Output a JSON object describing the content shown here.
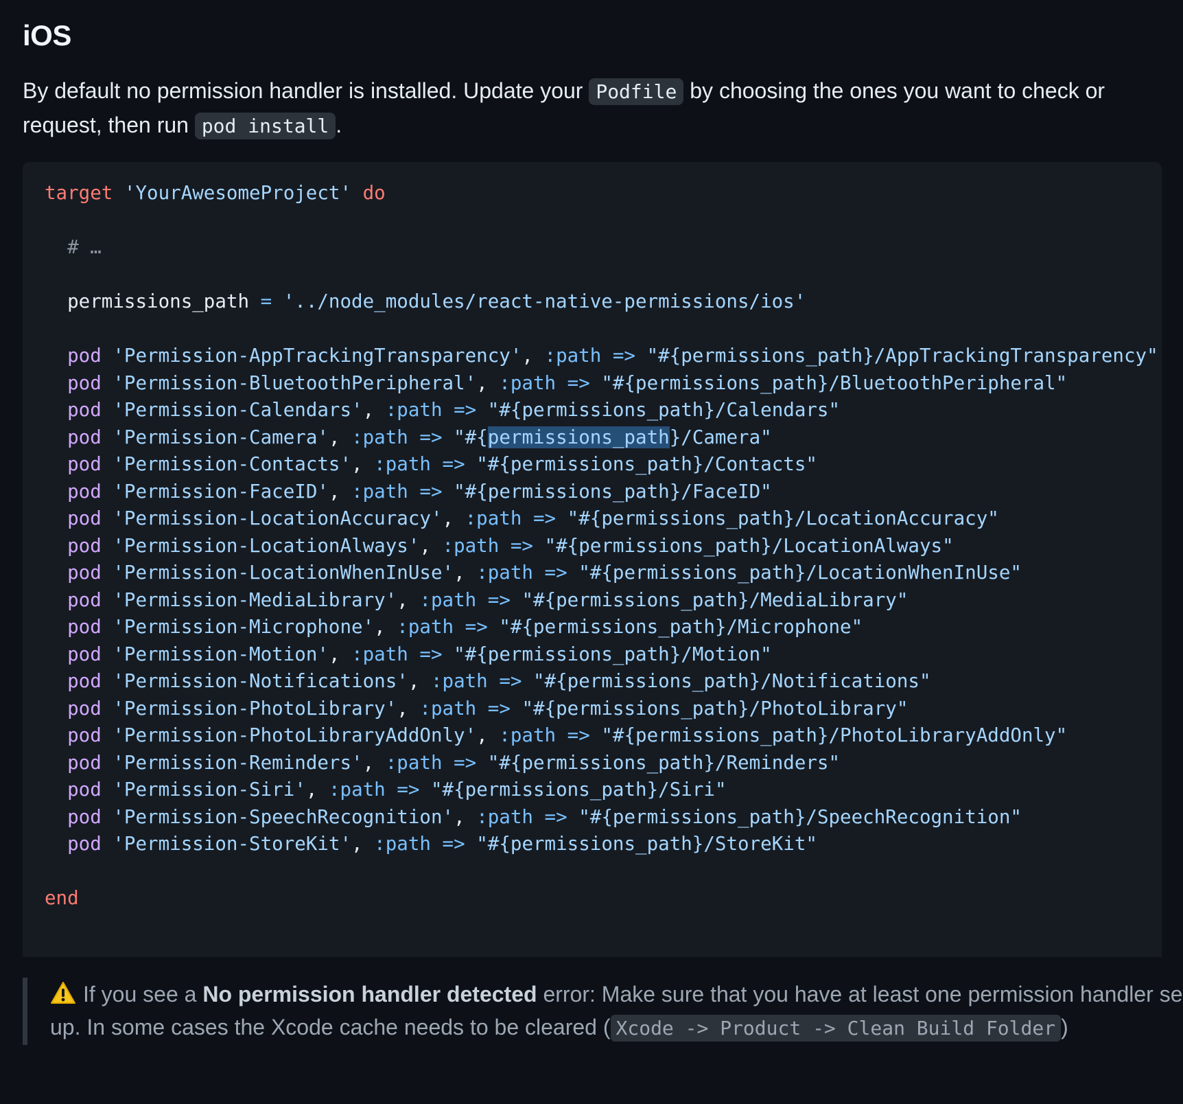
{
  "heading": "iOS",
  "intro": {
    "text_before": "By default no permission handler is installed. Update your ",
    "podfile_code": "Podfile",
    "text_middle": " by choosing the ones you want to check or request, then run ",
    "pod_install_code": "pod install",
    "text_end": "."
  },
  "code": {
    "target_kw": "target",
    "project_name": "'YourAwesomeProject'",
    "do_kw": "do",
    "comment": "# …",
    "permissions_var": "permissions_path",
    "equals": " = ",
    "permissions_value": "'../node_modules/react-native-permissions/ios'",
    "pod_kw": "pod",
    "path_symbol": ":path",
    "arrow": "=>",
    "path_prefix": "\"#{",
    "path_suffix_open": "}/",
    "pods": [
      {
        "name": "'Permission-AppTrackingTransparency'",
        "dir": "AppTrackingTransparency"
      },
      {
        "name": "'Permission-BluetoothPeripheral'",
        "dir": "BluetoothPeripheral"
      },
      {
        "name": "'Permission-Calendars'",
        "dir": "Calendars"
      },
      {
        "name": "'Permission-Camera'",
        "dir": "Camera"
      },
      {
        "name": "'Permission-Contacts'",
        "dir": "Contacts"
      },
      {
        "name": "'Permission-FaceID'",
        "dir": "FaceID"
      },
      {
        "name": "'Permission-LocationAccuracy'",
        "dir": "LocationAccuracy"
      },
      {
        "name": "'Permission-LocationAlways'",
        "dir": "LocationAlways"
      },
      {
        "name": "'Permission-LocationWhenInUse'",
        "dir": "LocationWhenInUse"
      },
      {
        "name": "'Permission-MediaLibrary'",
        "dir": "MediaLibrary"
      },
      {
        "name": "'Permission-Microphone'",
        "dir": "Microphone"
      },
      {
        "name": "'Permission-Motion'",
        "dir": "Motion"
      },
      {
        "name": "'Permission-Notifications'",
        "dir": "Notifications"
      },
      {
        "name": "'Permission-PhotoLibrary'",
        "dir": "PhotoLibrary"
      },
      {
        "name": "'Permission-PhotoLibraryAddOnly'",
        "dir": "PhotoLibraryAddOnly"
      },
      {
        "name": "'Permission-Reminders'",
        "dir": "Reminders"
      },
      {
        "name": "'Permission-Siri'",
        "dir": "Siri"
      },
      {
        "name": "'Permission-SpeechRecognition'",
        "dir": "SpeechRecognition"
      },
      {
        "name": "'Permission-StoreKit'",
        "dir": "StoreKit"
      }
    ],
    "end_kw": "end",
    "selected_pod_index": 3
  },
  "note": {
    "icon": "warning-icon",
    "text_before": "If you see a ",
    "bold": "No permission handler detected",
    "text_middle": " error: Make sure that you have at least one permission handler set up. In some cases the Xcode cache needs to be cleared (",
    "code": "Xcode -> Product -> Clean Build Folder",
    "text_end": ")"
  },
  "colors": {
    "background": "#0d1117",
    "code_background": "#161b22",
    "keyword": "#ff7b72",
    "string": "#a5d6ff",
    "pod": "#d2a8ff",
    "symbol": "#79c0ff"
  }
}
